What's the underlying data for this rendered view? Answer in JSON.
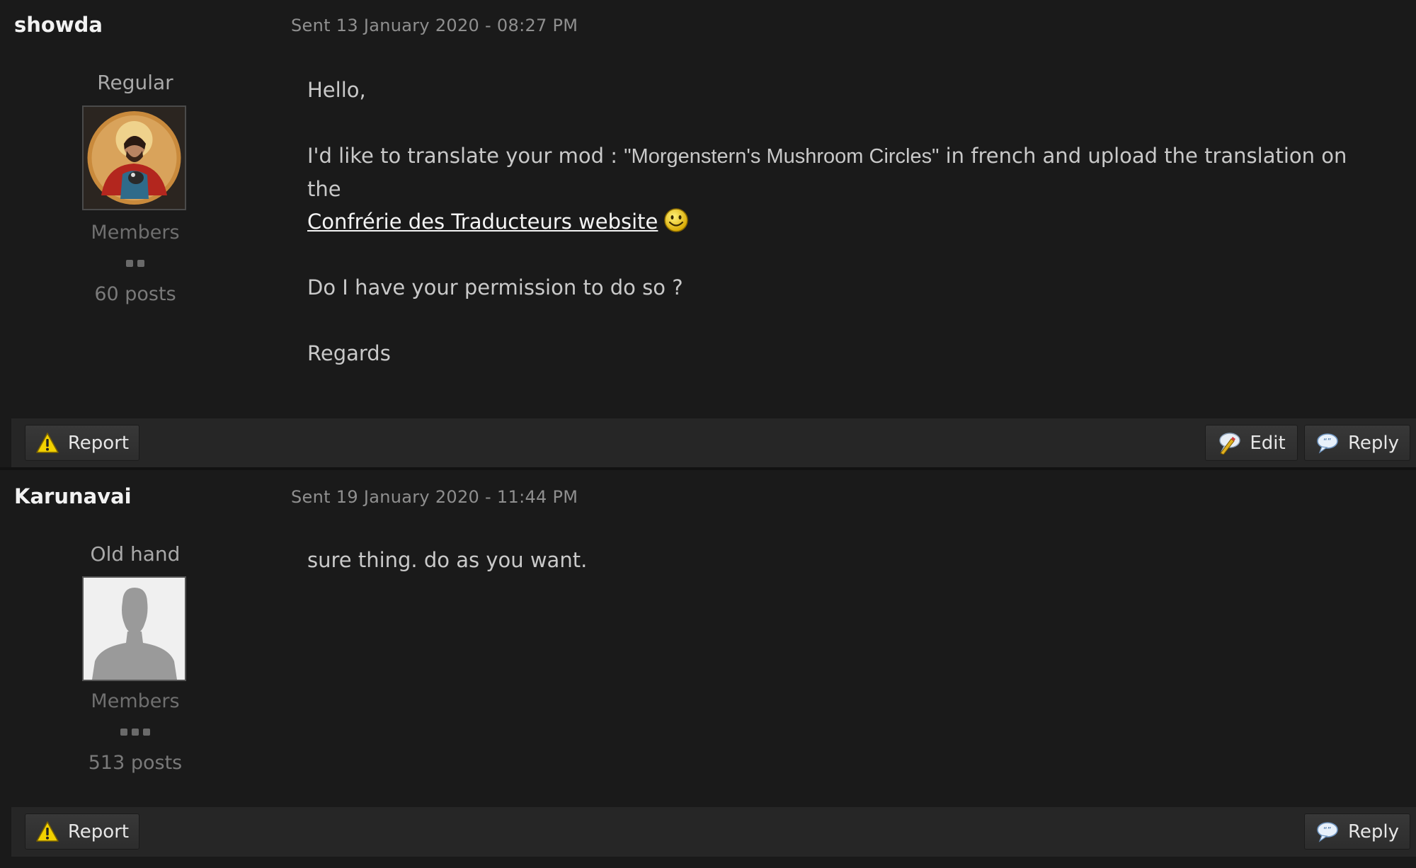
{
  "posts": [
    {
      "author": "showda",
      "sent": "Sent 13 January 2020 - 08:27 PM",
      "rank": "Regular",
      "group": "Members",
      "pips": 2,
      "post_count": "60 posts",
      "body": {
        "greeting": "Hello,",
        "line1_part1": "I'd like to translate your mod : ",
        "line1_quote": "\"Morgenstern's Mushroom Circles\"",
        "line1_part2": " in french and upload the translation on the",
        "link_text": "Confrérie des Traducteurs website",
        "question": "Do I have your permission to do so ?",
        "closing": "Regards"
      },
      "actions": {
        "report": "Report",
        "edit": "Edit",
        "reply": "Reply"
      }
    },
    {
      "author": "Karunavai",
      "sent": "Sent 19 January 2020 - 11:44 PM",
      "rank": "Old hand",
      "group": "Members",
      "pips": 3,
      "post_count": "513 posts",
      "body": {
        "text": "sure thing. do as you want."
      },
      "actions": {
        "report": "Report",
        "reply": "Reply"
      }
    }
  ],
  "icons": {
    "report": "warning-triangle-icon",
    "edit": "edit-bubble-icon",
    "reply": "reply-bubble-icon",
    "smiley": "smiley-emoticon"
  },
  "colors": {
    "background": "#1a1a1a",
    "link": "#f5f5f5",
    "author": "#f2f2f2"
  }
}
